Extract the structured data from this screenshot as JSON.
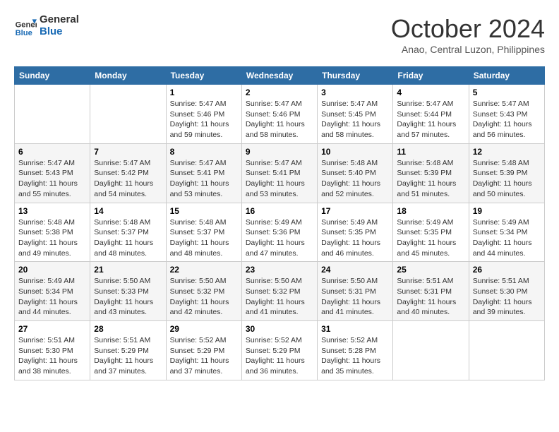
{
  "logo": {
    "line1": "General",
    "line2": "Blue"
  },
  "title": "October 2024",
  "location": "Anao, Central Luzon, Philippines",
  "weekdays": [
    "Sunday",
    "Monday",
    "Tuesday",
    "Wednesday",
    "Thursday",
    "Friday",
    "Saturday"
  ],
  "weeks": [
    [
      {
        "day": "",
        "sunrise": "",
        "sunset": "",
        "daylight": ""
      },
      {
        "day": "",
        "sunrise": "",
        "sunset": "",
        "daylight": ""
      },
      {
        "day": "1",
        "sunrise": "Sunrise: 5:47 AM",
        "sunset": "Sunset: 5:46 PM",
        "daylight": "Daylight: 11 hours and 59 minutes."
      },
      {
        "day": "2",
        "sunrise": "Sunrise: 5:47 AM",
        "sunset": "Sunset: 5:46 PM",
        "daylight": "Daylight: 11 hours and 58 minutes."
      },
      {
        "day": "3",
        "sunrise": "Sunrise: 5:47 AM",
        "sunset": "Sunset: 5:45 PM",
        "daylight": "Daylight: 11 hours and 58 minutes."
      },
      {
        "day": "4",
        "sunrise": "Sunrise: 5:47 AM",
        "sunset": "Sunset: 5:44 PM",
        "daylight": "Daylight: 11 hours and 57 minutes."
      },
      {
        "day": "5",
        "sunrise": "Sunrise: 5:47 AM",
        "sunset": "Sunset: 5:43 PM",
        "daylight": "Daylight: 11 hours and 56 minutes."
      }
    ],
    [
      {
        "day": "6",
        "sunrise": "Sunrise: 5:47 AM",
        "sunset": "Sunset: 5:43 PM",
        "daylight": "Daylight: 11 hours and 55 minutes."
      },
      {
        "day": "7",
        "sunrise": "Sunrise: 5:47 AM",
        "sunset": "Sunset: 5:42 PM",
        "daylight": "Daylight: 11 hours and 54 minutes."
      },
      {
        "day": "8",
        "sunrise": "Sunrise: 5:47 AM",
        "sunset": "Sunset: 5:41 PM",
        "daylight": "Daylight: 11 hours and 53 minutes."
      },
      {
        "day": "9",
        "sunrise": "Sunrise: 5:47 AM",
        "sunset": "Sunset: 5:41 PM",
        "daylight": "Daylight: 11 hours and 53 minutes."
      },
      {
        "day": "10",
        "sunrise": "Sunrise: 5:48 AM",
        "sunset": "Sunset: 5:40 PM",
        "daylight": "Daylight: 11 hours and 52 minutes."
      },
      {
        "day": "11",
        "sunrise": "Sunrise: 5:48 AM",
        "sunset": "Sunset: 5:39 PM",
        "daylight": "Daylight: 11 hours and 51 minutes."
      },
      {
        "day": "12",
        "sunrise": "Sunrise: 5:48 AM",
        "sunset": "Sunset: 5:39 PM",
        "daylight": "Daylight: 11 hours and 50 minutes."
      }
    ],
    [
      {
        "day": "13",
        "sunrise": "Sunrise: 5:48 AM",
        "sunset": "Sunset: 5:38 PM",
        "daylight": "Daylight: 11 hours and 49 minutes."
      },
      {
        "day": "14",
        "sunrise": "Sunrise: 5:48 AM",
        "sunset": "Sunset: 5:37 PM",
        "daylight": "Daylight: 11 hours and 48 minutes."
      },
      {
        "day": "15",
        "sunrise": "Sunrise: 5:48 AM",
        "sunset": "Sunset: 5:37 PM",
        "daylight": "Daylight: 11 hours and 48 minutes."
      },
      {
        "day": "16",
        "sunrise": "Sunrise: 5:49 AM",
        "sunset": "Sunset: 5:36 PM",
        "daylight": "Daylight: 11 hours and 47 minutes."
      },
      {
        "day": "17",
        "sunrise": "Sunrise: 5:49 AM",
        "sunset": "Sunset: 5:35 PM",
        "daylight": "Daylight: 11 hours and 46 minutes."
      },
      {
        "day": "18",
        "sunrise": "Sunrise: 5:49 AM",
        "sunset": "Sunset: 5:35 PM",
        "daylight": "Daylight: 11 hours and 45 minutes."
      },
      {
        "day": "19",
        "sunrise": "Sunrise: 5:49 AM",
        "sunset": "Sunset: 5:34 PM",
        "daylight": "Daylight: 11 hours and 44 minutes."
      }
    ],
    [
      {
        "day": "20",
        "sunrise": "Sunrise: 5:49 AM",
        "sunset": "Sunset: 5:34 PM",
        "daylight": "Daylight: 11 hours and 44 minutes."
      },
      {
        "day": "21",
        "sunrise": "Sunrise: 5:50 AM",
        "sunset": "Sunset: 5:33 PM",
        "daylight": "Daylight: 11 hours and 43 minutes."
      },
      {
        "day": "22",
        "sunrise": "Sunrise: 5:50 AM",
        "sunset": "Sunset: 5:32 PM",
        "daylight": "Daylight: 11 hours and 42 minutes."
      },
      {
        "day": "23",
        "sunrise": "Sunrise: 5:50 AM",
        "sunset": "Sunset: 5:32 PM",
        "daylight": "Daylight: 11 hours and 41 minutes."
      },
      {
        "day": "24",
        "sunrise": "Sunrise: 5:50 AM",
        "sunset": "Sunset: 5:31 PM",
        "daylight": "Daylight: 11 hours and 41 minutes."
      },
      {
        "day": "25",
        "sunrise": "Sunrise: 5:51 AM",
        "sunset": "Sunset: 5:31 PM",
        "daylight": "Daylight: 11 hours and 40 minutes."
      },
      {
        "day": "26",
        "sunrise": "Sunrise: 5:51 AM",
        "sunset": "Sunset: 5:30 PM",
        "daylight": "Daylight: 11 hours and 39 minutes."
      }
    ],
    [
      {
        "day": "27",
        "sunrise": "Sunrise: 5:51 AM",
        "sunset": "Sunset: 5:30 PM",
        "daylight": "Daylight: 11 hours and 38 minutes."
      },
      {
        "day": "28",
        "sunrise": "Sunrise: 5:51 AM",
        "sunset": "Sunset: 5:29 PM",
        "daylight": "Daylight: 11 hours and 37 minutes."
      },
      {
        "day": "29",
        "sunrise": "Sunrise: 5:52 AM",
        "sunset": "Sunset: 5:29 PM",
        "daylight": "Daylight: 11 hours and 37 minutes."
      },
      {
        "day": "30",
        "sunrise": "Sunrise: 5:52 AM",
        "sunset": "Sunset: 5:29 PM",
        "daylight": "Daylight: 11 hours and 36 minutes."
      },
      {
        "day": "31",
        "sunrise": "Sunrise: 5:52 AM",
        "sunset": "Sunset: 5:28 PM",
        "daylight": "Daylight: 11 hours and 35 minutes."
      },
      {
        "day": "",
        "sunrise": "",
        "sunset": "",
        "daylight": ""
      },
      {
        "day": "",
        "sunrise": "",
        "sunset": "",
        "daylight": ""
      }
    ]
  ]
}
